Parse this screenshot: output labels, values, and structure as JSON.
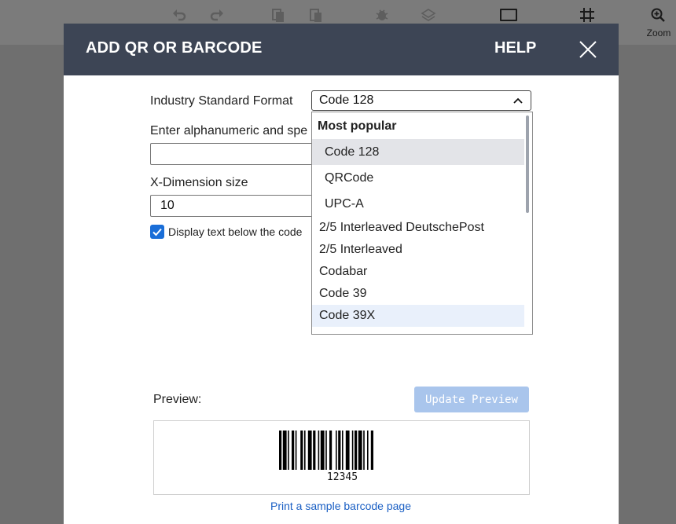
{
  "toolbar": {
    "zoom_label": "Zoom",
    "icons": [
      "undo-icon",
      "redo-icon",
      "copy-icon",
      "paste-icon",
      "bug-icon",
      "layers-icon",
      "rectangle-icon",
      "grid-icon",
      "zoom-icon"
    ]
  },
  "modal": {
    "title": "ADD QR OR BARCODE",
    "help_label": "HELP",
    "format_label": "Industry Standard Format",
    "format_selected": "Code 128",
    "data_label": "Enter alphanumeric and spe",
    "data_value": "",
    "xdim_label": "X-Dimension size",
    "xdim_value": "10",
    "display_text_label": "Display text below the code",
    "display_text_checked": true,
    "preview_label": "Preview:",
    "update_button_label": "Update Preview",
    "barcode_text": "12345",
    "sample_link": "Print a sample barcode page"
  },
  "dropdown": {
    "group_label": "Most popular",
    "group_options": [
      "Code 128",
      "QRCode",
      "UPC-A"
    ],
    "options": [
      "2/5 Interleaved DeutschePost",
      "2/5 Interleaved",
      "Codabar",
      "Code 39",
      "Code 39X"
    ],
    "selected": "Code 128",
    "hovered": "Code 39X"
  },
  "colors": {
    "header_bg": "#3d4555",
    "accent": "#1a6ed8",
    "link": "#1a5fc4",
    "button_disabled": "#a9c5ec"
  }
}
